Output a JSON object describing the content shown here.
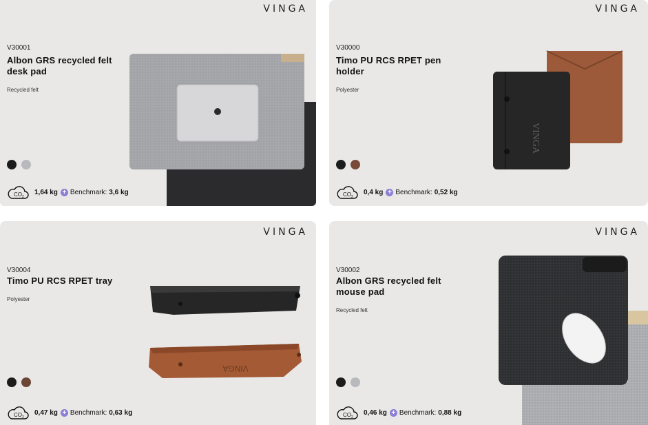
{
  "cards": [
    {
      "brand": "VINGA",
      "sku": "V30001",
      "title": "Albon GRS recycled felt desk pad",
      "material": "Recycled felt",
      "colors": [
        "#1c1c1c",
        "#b8b9bd"
      ],
      "co2_icon": "co2-cloud-icon",
      "co2_value": "1,64 kg",
      "benchmark_label": "Benchmark:",
      "benchmark_value": "3,6 kg"
    },
    {
      "brand": "VINGA",
      "sku": "V30000",
      "title": "Timo PU RCS RPET pen holder",
      "material": "Polyester",
      "colors": [
        "#1c1c1c",
        "#7a4a38"
      ],
      "co2_icon": "co2-cloud-icon",
      "co2_value": "0,4 kg",
      "benchmark_label": "Benchmark:",
      "benchmark_value": "0,52 kg"
    },
    {
      "brand": "VINGA",
      "sku": "V30004",
      "title": "Timo PU RCS RPET tray",
      "material": "Polyester",
      "colors": [
        "#1c1c1c",
        "#6b4536"
      ],
      "co2_icon": "co2-cloud-icon",
      "co2_value": "0,47 kg",
      "benchmark_label": "Benchmark:",
      "benchmark_value": "0,63 kg"
    },
    {
      "brand": "VINGA",
      "sku": "V30002",
      "title": "Albon GRS recycled felt mouse pad",
      "material": "Recycled felt",
      "colors": [
        "#1c1c1c",
        "#b8b9bd"
      ],
      "co2_icon": "co2-cloud-icon",
      "co2_value": "0,46 kg",
      "benchmark_label": "Benchmark:",
      "benchmark_value": "0,88 kg"
    }
  ],
  "accent_color": "#8b7fd6",
  "card_background": "#e9e8e7"
}
